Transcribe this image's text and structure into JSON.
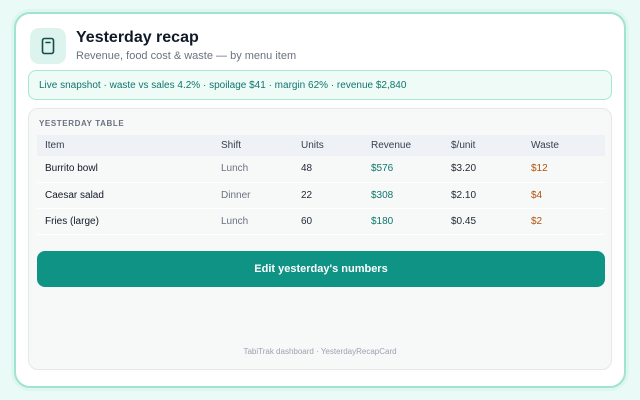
{
  "header": {
    "title": "Yesterday recap",
    "subtitle": "Revenue, food cost & waste — by menu item",
    "icon": "clipboard-icon"
  },
  "snapshot": {
    "text": "Live snapshot · waste vs sales 4.2% · spoilage $41 · margin 62% · revenue $2,840"
  },
  "table": {
    "label": "YESTERDAY TABLE",
    "columns": [
      "Item",
      "Shift",
      "Units",
      "Revenue",
      "$/unit",
      "Waste"
    ],
    "rows": [
      {
        "item": "Burrito bowl",
        "shift": "Lunch",
        "units": "48",
        "revenue": "$576",
        "per_unit": "$3.20",
        "waste": "$12"
      },
      {
        "item": "Caesar salad",
        "shift": "Dinner",
        "units": "22",
        "revenue": "$308",
        "per_unit": "$2.10",
        "waste": "$4"
      },
      {
        "item": "Fries (large)",
        "shift": "Lunch",
        "units": "60",
        "revenue": "$180",
        "per_unit": "$0.45",
        "waste": "$2"
      }
    ]
  },
  "actions": {
    "edit_label": "Edit yesterday's numbers"
  },
  "footer": {
    "text": "TabiTrak dashboard · YesterdayRecapCard"
  },
  "colors": {
    "accent": "#0e9384",
    "revenue": "#0f766e",
    "waste": "#b45309",
    "border": "#9fe3d2"
  }
}
